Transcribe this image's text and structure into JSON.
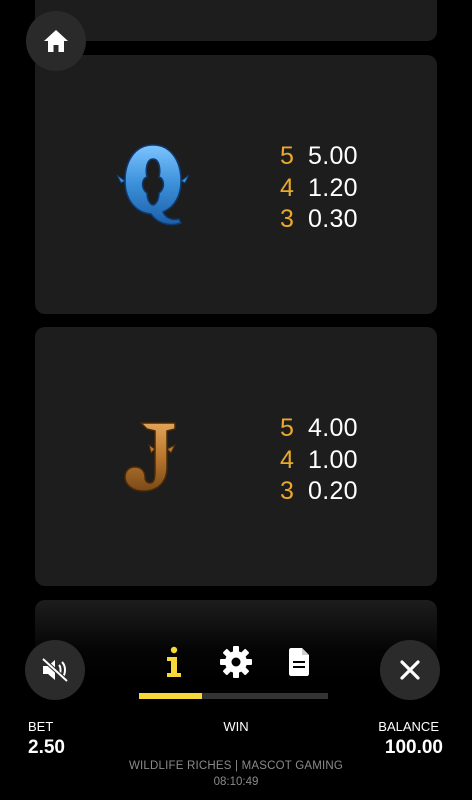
{
  "paytable": {
    "symbols": [
      {
        "icon": "queen-letter-icon",
        "color": "#3a8fd9",
        "payouts": [
          {
            "count": "5",
            "value": "5.00"
          },
          {
            "count": "4",
            "value": "1.20"
          },
          {
            "count": "3",
            "value": "0.30"
          }
        ]
      },
      {
        "icon": "jack-letter-icon",
        "color": "#b8762e",
        "payouts": [
          {
            "count": "5",
            "value": "4.00"
          },
          {
            "count": "4",
            "value": "1.00"
          },
          {
            "count": "3",
            "value": "0.20"
          }
        ]
      }
    ]
  },
  "controls": {
    "home_icon": "home-icon",
    "mute_icon": "speaker-muted-icon",
    "close_icon": "close-icon",
    "tabs": [
      {
        "icon": "info-icon",
        "active": true
      },
      {
        "icon": "gear-icon",
        "active": false
      },
      {
        "icon": "document-icon",
        "active": false
      }
    ],
    "accent_color": "#f6d838"
  },
  "status": {
    "bet_label": "BET",
    "bet_value": "2.50",
    "win_label": "WIN",
    "balance_label": "BALANCE",
    "balance_value": "100.00"
  },
  "footer": {
    "title": "WILDLIFE RICHES | MASCOT GAMING",
    "time": "08:10:49"
  }
}
